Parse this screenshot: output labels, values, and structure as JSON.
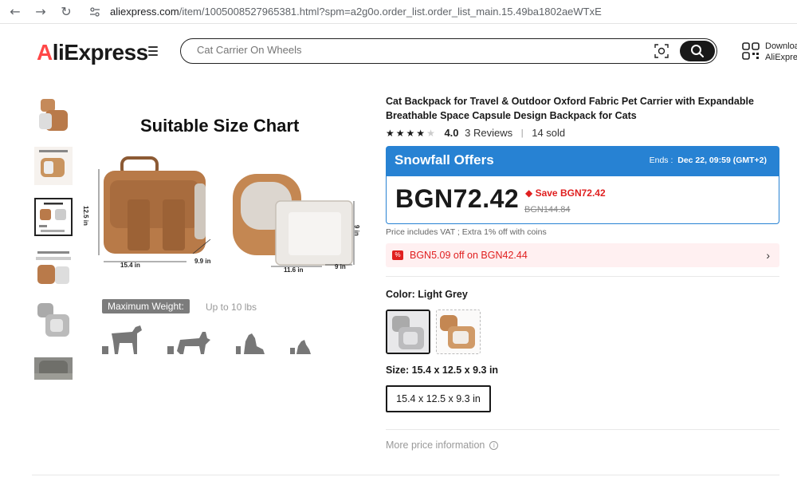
{
  "browser": {
    "nav_back": "←",
    "nav_forward": "→",
    "nav_reload": "↻",
    "url_host": "aliexpress.com",
    "url_path": "/item/1005008527965381.html?spm=a2g0o.order_list.order_list_main.15.49ba1802aeWTxE"
  },
  "header": {
    "logo_prefix": "A",
    "logo_rest": "liExpress",
    "search_placeholder": "Cat Carrier On Wheels",
    "download_line1": "Download",
    "download_line2": "AliExpre"
  },
  "gallery": {
    "chart_title": "Suitable Size Chart",
    "dims": {
      "height1": "12.5 in",
      "width1": "15.4 in",
      "depth1": "9.9 in",
      "height2": "9 in",
      "width2": "11.6 in",
      "depth2": "9 in"
    },
    "max_weight_label": "Maximum Weight:",
    "max_weight_value": "Up to 10 lbs"
  },
  "product": {
    "title": "Cat Backpack for Travel & Outdoor Oxford Fabric Pet Carrier with Expandable Breathable Space Capsule Design Backpack for Cats",
    "rating": "4.0",
    "stars_filled": 4,
    "stars_total": 5,
    "reviews": "3 Reviews",
    "separator": "|",
    "sold": "14 sold"
  },
  "offer": {
    "title": "Snowfall Offers",
    "ends_label": "Ends :",
    "ends_value": "Dec 22, 09:59 (GMT+2)",
    "price": "BGN72.42",
    "save": "Save BGN72.42",
    "original_price": "BGN144.84",
    "vat_note": "Price includes VAT ; Extra 1% off with coins",
    "coupon_text": "BGN5.09 off on BGN42.44",
    "accent_color": "#2782d3",
    "sale_color": "#e02020"
  },
  "options": {
    "color_label": "Color: Light Grey",
    "size_label": "Size: 15.4 x 12.5 x 9.3 in",
    "size_option": "15.4 x 12.5 x 9.3 in",
    "more_price_info": "More price information"
  }
}
